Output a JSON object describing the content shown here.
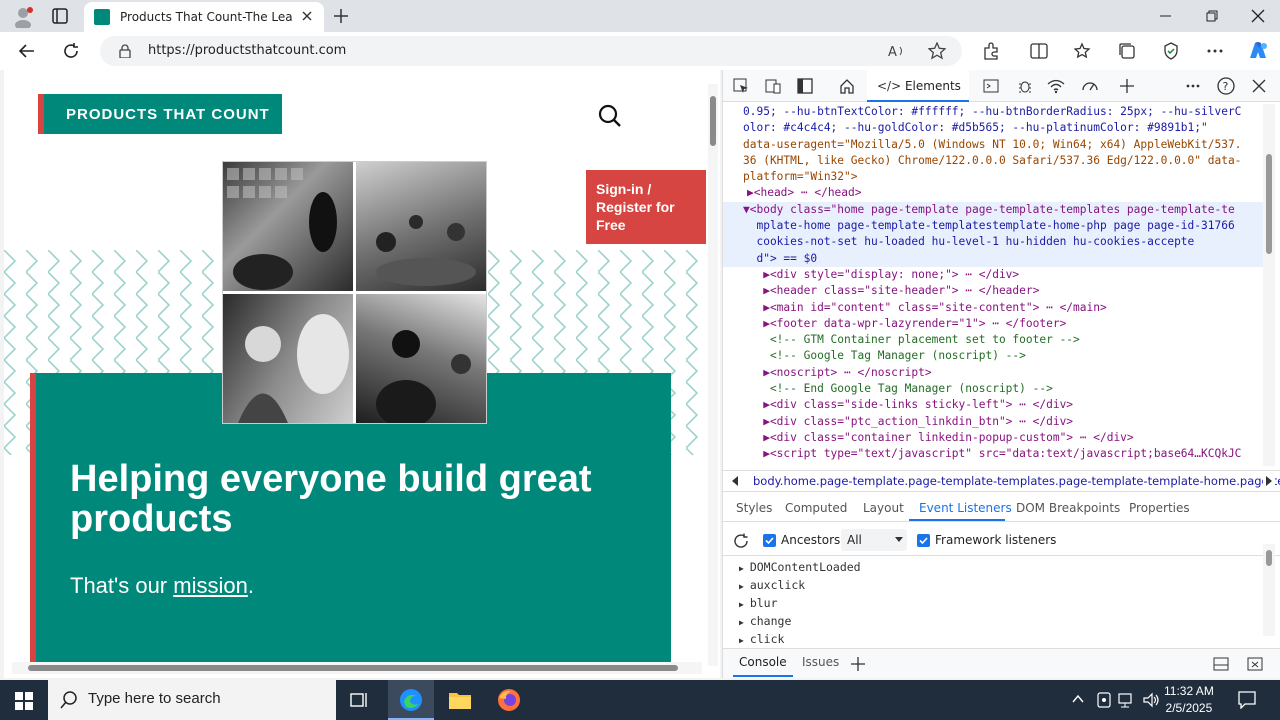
{
  "browser": {
    "tab_title": "Products That Count-The Leader",
    "url": "https://productsthatcount.com",
    "colors": {
      "tab_active": "#ffffff",
      "titlebar": "#dfe3e8"
    }
  },
  "page": {
    "logo": "PRODUCTS THAT COUNT",
    "signin": "Sign-in / Register for Free",
    "headline": "Helping everyone build great products",
    "mission_prefix": "That's our ",
    "mission_link": "mission",
    "mission_suffix": ".",
    "colors": {
      "brand": "#00897b",
      "accent": "#d64541"
    }
  },
  "devtools": {
    "elements_tab": "Elements",
    "code_lines": [
      {
        "text": "0.95; --hu-btnTextColor: #ffffff; --hu-btnBorderRadius: 25px; --hu-silverC",
        "cls": "v"
      },
      {
        "text": "olor: #c4c4c4; --hu-goldColor: #d5b565; --hu-platinumColor: #9891b1;\"",
        "cls": "v"
      },
      {
        "text": "data-useragent=\"Mozilla/5.0 (Windows NT 10.0; Win64; x64) AppleWebKit/537.",
        "cls": "a"
      },
      {
        "text": "36 (KHTML, like Gecko) Chrome/122.0.0.0 Safari/537.36 Edg/122.0.0.0\" data-",
        "cls": "a"
      },
      {
        "text": "platform=\"Win32\">",
        "cls": "a"
      },
      {
        "text": "▶<head> ⋯ </head>",
        "cls": "t"
      },
      {
        "text": "▼<body class=\"home page-template page-template-templates page-template-te",
        "cls": "t"
      },
      {
        "text": "  mplate-home page-template-templatestemplate-home-php page page-id-31766",
        "cls": "v"
      },
      {
        "text": "  cookies-not-set hu-loaded hu-level-1 hu-hidden hu-cookies-accepte",
        "cls": "v"
      },
      {
        "text": "  d\"> == $0",
        "cls": "v"
      },
      {
        "text": "   ▶<div style=\"display: none;\"> ⋯ </div>",
        "cls": "t"
      },
      {
        "text": "   ▶<header class=\"site-header\"> ⋯ </header>",
        "cls": "t"
      },
      {
        "text": "   ▶<main id=\"content\" class=\"site-content\"> ⋯ </main>",
        "cls": "t"
      },
      {
        "text": "   ▶<footer data-wpr-lazyrender=\"1\"> ⋯ </footer>",
        "cls": "t"
      },
      {
        "text": "    <!-- GTM Container placement set to footer -->",
        "cls": "c"
      },
      {
        "text": "    <!-- Google Tag Manager (noscript) -->",
        "cls": "c"
      },
      {
        "text": "   ▶<noscript> ⋯ </noscript>",
        "cls": "t"
      },
      {
        "text": "    <!-- End Google Tag Manager (noscript) -->",
        "cls": "c"
      },
      {
        "text": "   ▶<div class=\"side-links sticky-left\"> ⋯ </div>",
        "cls": "t"
      },
      {
        "text": "   ▶<div class=\"ptc_action_linkdin_btn\"> ⋯ </div>",
        "cls": "t"
      },
      {
        "text": "   ▶<div class=\"container linkedin-popup-custom\"> ⋯ </div>",
        "cls": "t"
      },
      {
        "text": "   ▶<script type=\"text/javascript\" src=\"data:text/javascript;base64…KCQkJC",
        "cls": "t"
      }
    ],
    "breadcrumb": "body.home.page-template.page-template-templates.page-template-template-home.page-ten",
    "subtabs": [
      "Styles",
      "Computed",
      "Layout",
      "Event Listeners",
      "DOM Breakpoints",
      "Properties"
    ],
    "ancestors_label": "Ancestors",
    "filter_value": "All",
    "framework_label": "Framework listeners",
    "events": [
      "DOMContentLoaded",
      "auxclick",
      "blur",
      "change",
      "click"
    ],
    "drawer_tabs": [
      "Console",
      "Issues"
    ],
    "colors": {
      "selected": "#1a73e8"
    }
  },
  "taskbar": {
    "search_placeholder": "Type here to search",
    "time": "11:32 AM",
    "date": "2/5/2025"
  }
}
